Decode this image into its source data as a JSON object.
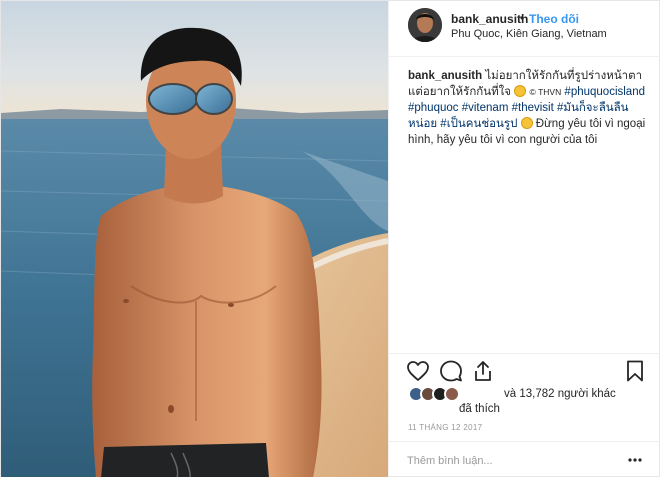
{
  "post": {
    "username": "bank_anusith",
    "separator": "•",
    "follow_label": "Theo dõi",
    "location": "Phu Quoc, Kiên Giang, Vietnam"
  },
  "caption": {
    "username": "bank_anusith",
    "text_1": "ไม่อยากให้รักกันที่รูปร่างหน้าตา แต่อยากให้รักกันที่ใจ",
    "credit": "© THVN",
    "hashtags": [
      "#phuquocisland",
      "#phuquoc",
      "#vitenam",
      "#thevisit",
      "#มันก็จะลืนลืนหน่อย",
      "#เป็นคนช่อนรูป"
    ],
    "text_2": "Đừng yêu tôi vì ngoại hình, hãy yêu tôi vì con người của tôi"
  },
  "actions": {
    "like_icon": "heart-icon",
    "comment_icon": "speech-bubble-icon",
    "share_icon": "share-icon",
    "save_icon": "bookmark-icon"
  },
  "likes": {
    "count_text": "và 13,782 người khác",
    "suffix_text": "đã thích"
  },
  "date": "11 THÁNG 12 2017",
  "comment": {
    "placeholder": "Thêm bình luận...",
    "more_icon": "ellipsis-icon"
  },
  "colors": {
    "link_blue": "#3897f0",
    "hashtag_blue": "#003569",
    "muted": "#999999",
    "text": "#262626"
  }
}
